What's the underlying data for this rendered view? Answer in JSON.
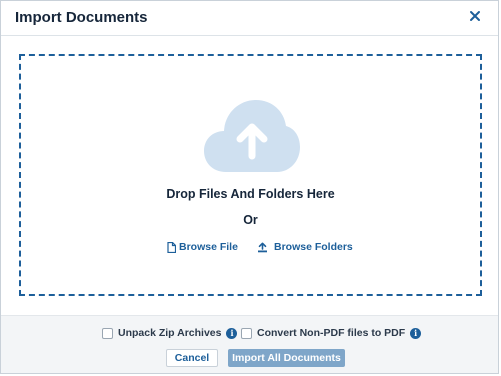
{
  "dialog": {
    "title": "Import Documents",
    "close_icon": "close-icon"
  },
  "dropzone": {
    "cloud_icon": "cloud-upload-icon",
    "drop_text": "Drop Files And Folders Here",
    "or_text": "Or",
    "browse_file_label": "Browse File",
    "browse_file_icon": "file-icon",
    "browse_folders_label": "Browse Folders",
    "browse_folders_icon": "upload-icon"
  },
  "options": {
    "unpack_zip": {
      "label": "Unpack Zip Archives",
      "checked": false
    },
    "convert_pdf": {
      "label": "Convert Non-PDF files to PDF",
      "checked": false
    }
  },
  "buttons": {
    "cancel_label": "Cancel",
    "import_label": "Import All Documents"
  },
  "colors": {
    "accent": "#1d5f9a",
    "cloud": "#cfe0f0",
    "import_button": "#7fa6c9"
  }
}
